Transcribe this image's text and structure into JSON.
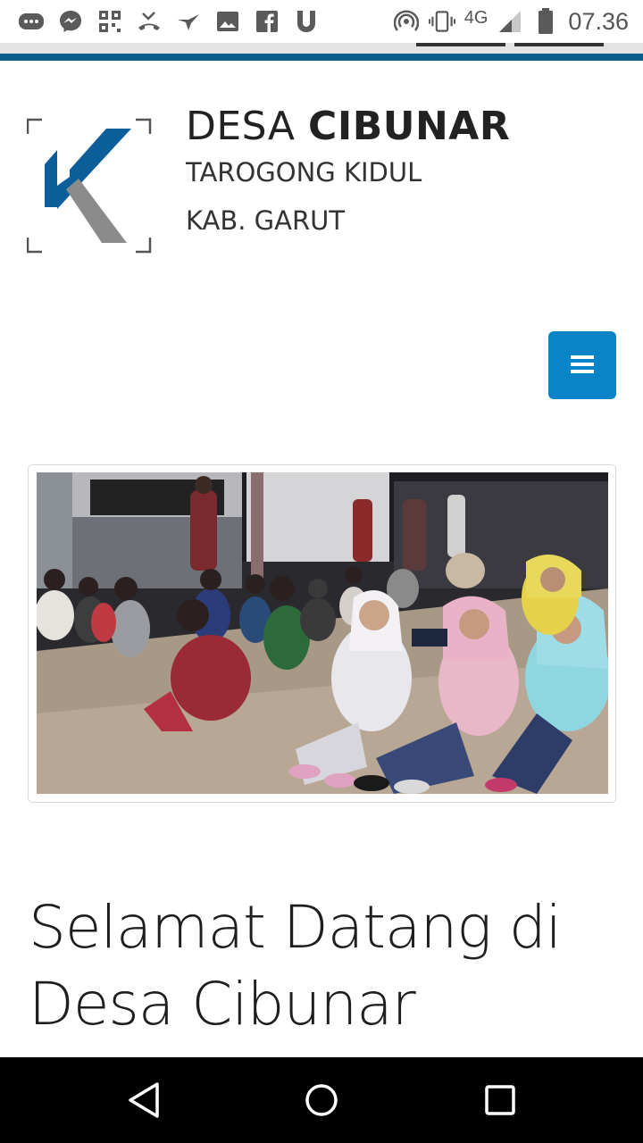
{
  "status_bar": {
    "network": "4G",
    "time": "07.36",
    "icons": [
      "chat-icon",
      "messenger-icon",
      "qr-icon",
      "missed-call-icon",
      "bird-icon",
      "image-icon",
      "facebook-icon",
      "u-app-icon",
      "hotspot-icon",
      "vibrate-icon",
      "signal-icon",
      "battery-icon"
    ]
  },
  "header": {
    "title_prefix": "DESA",
    "title_bold": "CIBUNAR",
    "line1": "TAROGONG KIDUL",
    "line2": "KAB. GARUT",
    "logo_letter": "K",
    "colors": {
      "logo_blue": "#0b5e99",
      "logo_grey": "#8b8b8b",
      "menu_blue": "#0a84c8"
    }
  },
  "menu_button": {
    "icon": "hamburger-icon"
  },
  "hero": {
    "image": "photo-children-sitting-outdoors-at-night"
  },
  "welcome": {
    "line1": "Selamat Datang di",
    "line2": "Desa Cibunar"
  },
  "nav_bar": {
    "buttons": [
      "back-icon",
      "home-icon",
      "recents-icon"
    ]
  }
}
